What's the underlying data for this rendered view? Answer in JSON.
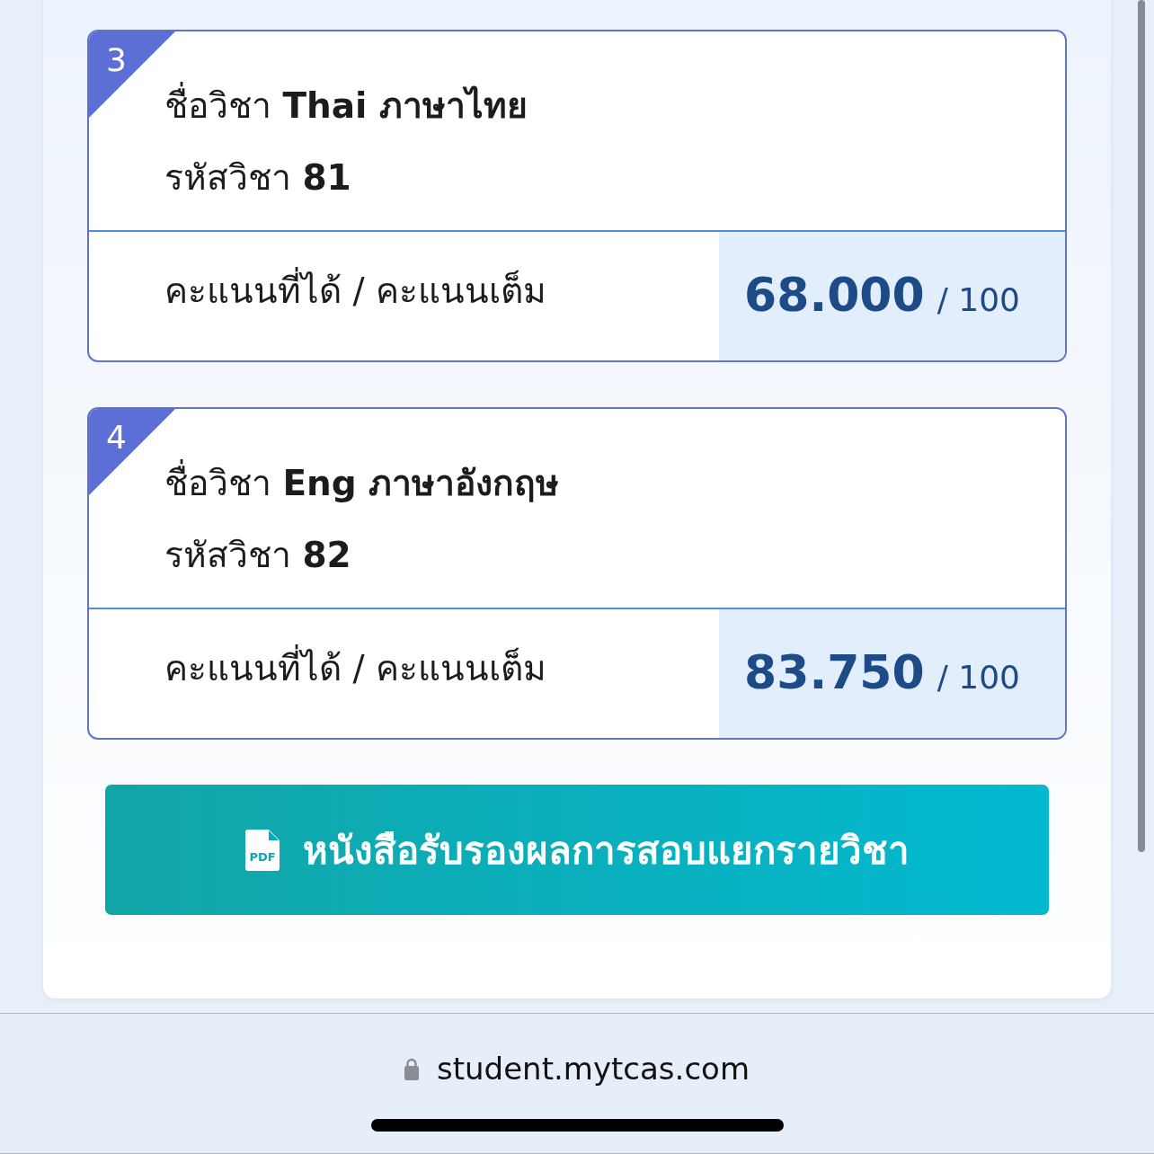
{
  "subjects": [
    {
      "number": "3",
      "name": "ชื่อวิชา **Thai ภาษาไทย**",
      "code": "รหัสวิชา **81**",
      "score_label": "คะแนนที่ได้ / คะแนนเต็ม",
      "score": "68.000",
      "full_score": "/ 100"
    },
    {
      "number": "4",
      "name": "ชื่อวิชา **Eng ภาษาอังกฤษ**",
      "code": "รหัสวิชา **82**",
      "score_label": "คะแนนที่ได้ / คะแนนเต็ม",
      "score": "83.750",
      "full_score": "/ 100"
    }
  ],
  "certificate_button": {
    "icon_text": "PDF",
    "label": "หนังสือรับรองผลการสอบแยกรายวิชา"
  },
  "browser_bar": {
    "url": "student.mytcas.com"
  }
}
